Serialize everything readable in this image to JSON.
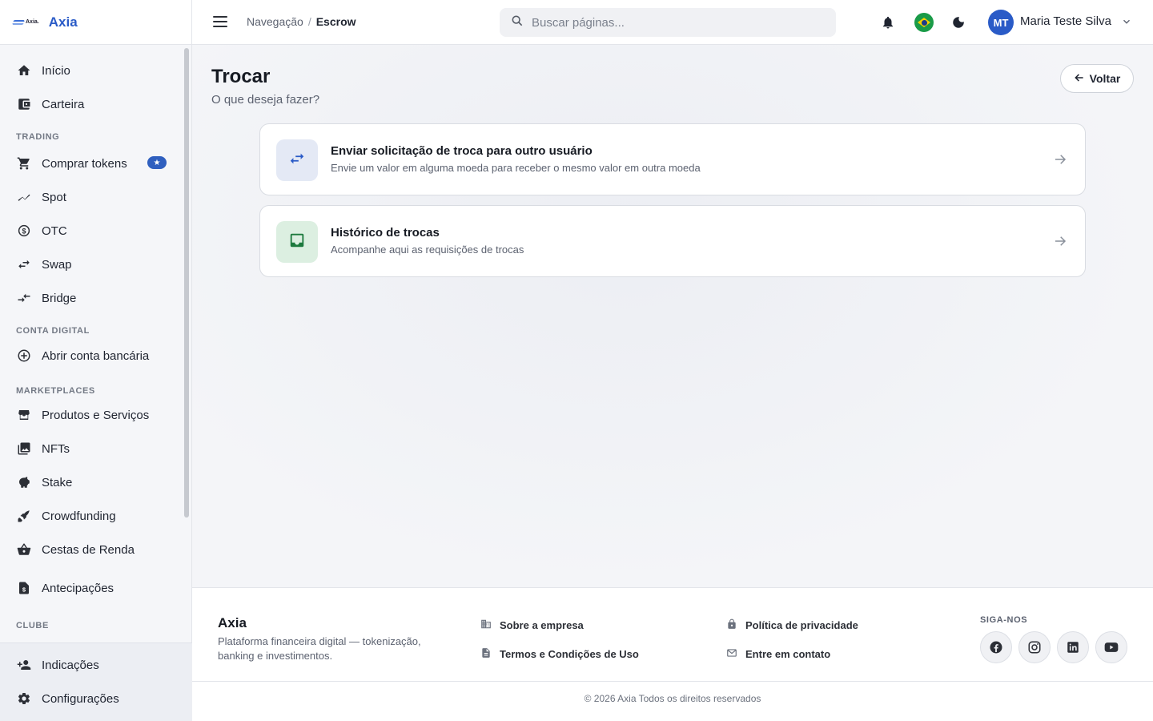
{
  "brand": {
    "name": "Axia",
    "mini_logo_text": "Axia."
  },
  "sidebar": {
    "items_top": [
      {
        "label": "Início",
        "icon": "home-icon"
      },
      {
        "label": "Carteira",
        "icon": "wallet-icon"
      }
    ],
    "trading_title": "TRADING",
    "trading": [
      {
        "label": "Comprar tokens",
        "icon": "cart-icon"
      },
      {
        "label": "Spot",
        "icon": "trend-icon"
      },
      {
        "label": "OTC",
        "icon": "currency-exchange-icon"
      },
      {
        "label": "Swap",
        "icon": "swap-arrows-icon"
      },
      {
        "label": "Bridge",
        "icon": "bridge-arrows-icon"
      }
    ],
    "conta_title": "CONTA DIGITAL",
    "conta": [
      {
        "label": "Abrir conta bancária",
        "icon": "add-circle-icon"
      }
    ],
    "market_title": "MARKETPLACES",
    "market": [
      {
        "label": "Produtos e Serviços",
        "icon": "store-icon"
      },
      {
        "label": "NFTs",
        "icon": "image-collection-icon"
      },
      {
        "label": "Stake",
        "icon": "piggy-bank-icon"
      },
      {
        "label": "Crowdfunding",
        "icon": "rocket-icon"
      },
      {
        "label": "Cestas de Renda",
        "icon": "basket-icon"
      },
      {
        "label": "Antecipações",
        "icon": "document-dollar-icon"
      }
    ],
    "clube_title": "CLUBE",
    "bottom": [
      {
        "label": "Indicações",
        "icon": "person-add-icon"
      },
      {
        "label": "Configurações",
        "icon": "gear-icon"
      }
    ]
  },
  "header": {
    "breadcrumb": [
      "Navegação",
      "Escrow"
    ],
    "search_placeholder": "Buscar páginas...",
    "avatar_initials": "MT",
    "user_name": "Maria Teste Silva"
  },
  "main": {
    "title": "Trocar",
    "subtitle": "O que deseja fazer?",
    "back_label": "Voltar",
    "cards": [
      {
        "title": "Enviar solicitação de troca para outro usuário",
        "desc": "Envie um valor em alguma moeda para receber o mesmo valor em outra moeda",
        "icon": "swap-arrows-icon",
        "tile_color": "#e4e9f5",
        "icon_color": "#2a5bc7"
      },
      {
        "title": "Histórico de trocas",
        "desc": "Acompanhe aqui as requisições de trocas",
        "icon": "inbox-icon",
        "tile_color": "#dcefe1",
        "icon_color": "#1d7a3e"
      }
    ]
  },
  "footer": {
    "brand": "Axia",
    "desc": "Plataforma financeira digital — tokenização, banking e investimentos.",
    "links": [
      "Sobre a empresa",
      "Termos e Condições de Uso",
      "Política de privacidade",
      "Entre em contato"
    ],
    "follow_title": "SIGA-NOS",
    "social": [
      "facebook-icon",
      "instagram-icon",
      "linkedin-icon",
      "youtube-icon"
    ],
    "copyright": "© 2026 Axia Todos os direitos reservados"
  },
  "colors": {
    "accent": "#2a5bc7",
    "text": "#1f2430",
    "muted": "#5c6270"
  }
}
